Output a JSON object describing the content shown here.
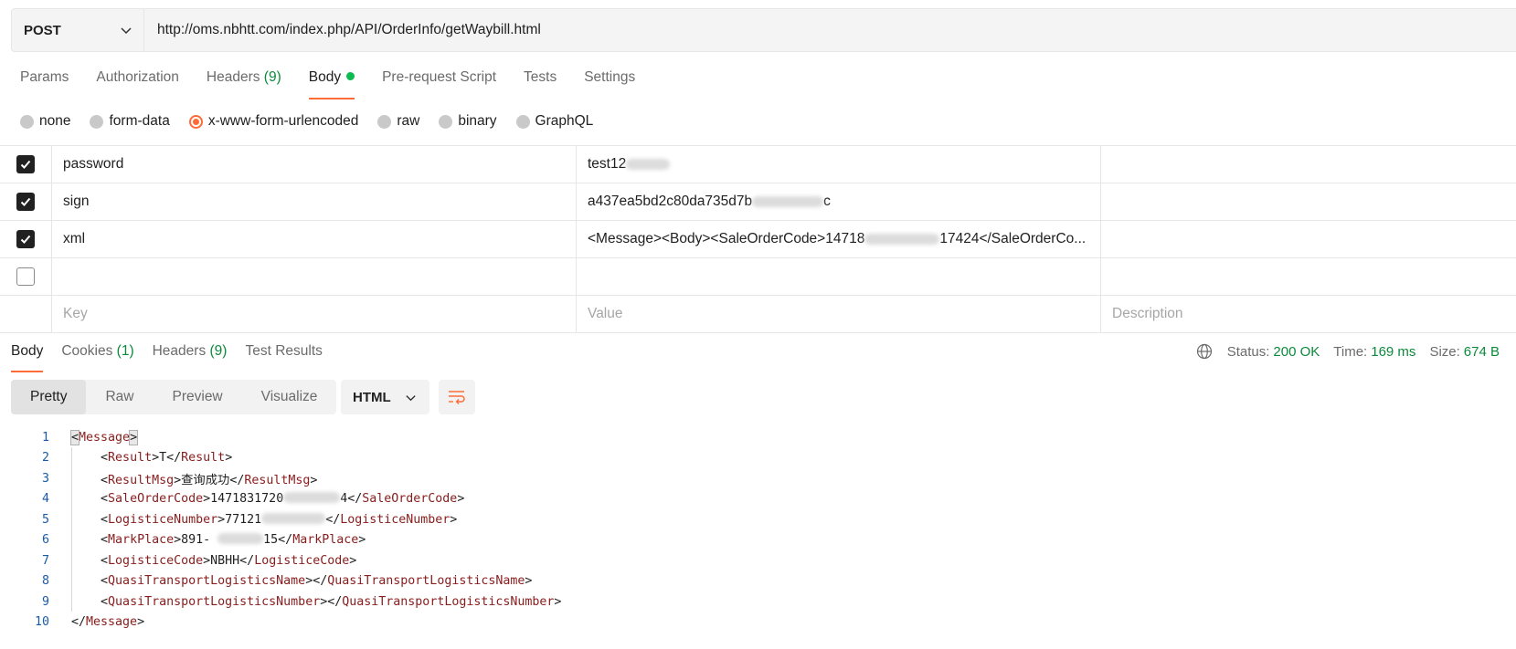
{
  "request": {
    "method": "POST",
    "url": "http://oms.nbhtt.com/index.php/API/OrderInfo/getWaybill.html"
  },
  "request_tabs": [
    {
      "label": "Params",
      "count": "",
      "active": false
    },
    {
      "label": "Authorization",
      "count": "",
      "active": false
    },
    {
      "label": "Headers",
      "count": "(9)",
      "active": false
    },
    {
      "label": "Body",
      "count": "",
      "active": true
    },
    {
      "label": "Pre-request Script",
      "count": "",
      "active": false
    },
    {
      "label": "Tests",
      "count": "",
      "active": false
    },
    {
      "label": "Settings",
      "count": "",
      "active": false
    }
  ],
  "body_types": [
    {
      "label": "none",
      "active": false
    },
    {
      "label": "form-data",
      "active": false
    },
    {
      "label": "x-www-form-urlencoded",
      "active": true
    },
    {
      "label": "raw",
      "active": false
    },
    {
      "label": "binary",
      "active": false
    },
    {
      "label": "GraphQL",
      "active": false
    }
  ],
  "params": [
    {
      "checked": true,
      "key": "password",
      "value_visible": "test12",
      "value_tail": ""
    },
    {
      "checked": true,
      "key": "sign",
      "value_visible": "a437ea5bd2c80da735d7b",
      "value_tail": "c"
    },
    {
      "checked": true,
      "key": "xml",
      "value_visible": "<Message><Body><SaleOrderCode>14718",
      "value_tail": "17424</SaleOrderCo..."
    },
    {
      "checked": false,
      "key": "",
      "value_visible": "",
      "value_tail": ""
    }
  ],
  "params_placeholder": {
    "key": "Key",
    "value": "Value",
    "description": "Description"
  },
  "response_tabs": [
    {
      "label": "Body",
      "count": "",
      "active": true
    },
    {
      "label": "Cookies",
      "count": "(1)",
      "active": false
    },
    {
      "label": "Headers",
      "count": "(9)",
      "active": false
    },
    {
      "label": "Test Results",
      "count": "",
      "active": false
    }
  ],
  "response_status": {
    "status_label": "Status:",
    "status_value": "200 OK",
    "time_label": "Time:",
    "time_value": "169 ms",
    "size_label": "Size:",
    "size_value": "674 B"
  },
  "view_modes": [
    {
      "label": "Pretty",
      "active": true
    },
    {
      "label": "Raw",
      "active": false
    },
    {
      "label": "Preview",
      "active": false
    },
    {
      "label": "Visualize",
      "active": false
    }
  ],
  "format": "HTML",
  "code_lines": [
    {
      "n": "1",
      "indent": "",
      "open": "Message",
      "text": "",
      "close": "",
      "tail": ""
    },
    {
      "n": "2",
      "indent": "    ",
      "open": "Result",
      "text": "T",
      "close": "Result",
      "tail": ""
    },
    {
      "n": "3",
      "indent": "    ",
      "open": "ResultMsg",
      "text": "查询成功",
      "close": "ResultMsg",
      "tail": ""
    },
    {
      "n": "4",
      "indent": "    ",
      "open": "SaleOrderCode",
      "text": "1471831720",
      "close": "SaleOrderCode",
      "tail": "4"
    },
    {
      "n": "5",
      "indent": "    ",
      "open": "LogisticeNumber",
      "text": "77121",
      "close": "LogisticeNumber",
      "tail": ""
    },
    {
      "n": "6",
      "indent": "    ",
      "open": "MarkPlace",
      "text": "891- ",
      "close": "MarkPlace",
      "tail": "15"
    },
    {
      "n": "7",
      "indent": "    ",
      "open": "LogisticeCode",
      "text": "NBHH",
      "close": "LogisticeCode",
      "tail": ""
    },
    {
      "n": "8",
      "indent": "    ",
      "open": "QuasiTransportLogisticsName",
      "text": "",
      "close": "QuasiTransportLogisticsName",
      "tail": ""
    },
    {
      "n": "9",
      "indent": "    ",
      "open": "QuasiTransportLogisticsNumber",
      "text": "",
      "close": "QuasiTransportLogisticsNumber",
      "tail": ""
    },
    {
      "n": "10",
      "indent": "",
      "open": "",
      "text": "",
      "close": "Message",
      "tail": ""
    }
  ],
  "icons": [
    "chevron-down-icon",
    "check-icon",
    "globe-icon",
    "wrap-lines-icon"
  ],
  "colors": {
    "accent": "#ff6c37",
    "success": "#0b8a3b",
    "tag": "#8b1c1c",
    "line_number": "#1b5aa8"
  }
}
